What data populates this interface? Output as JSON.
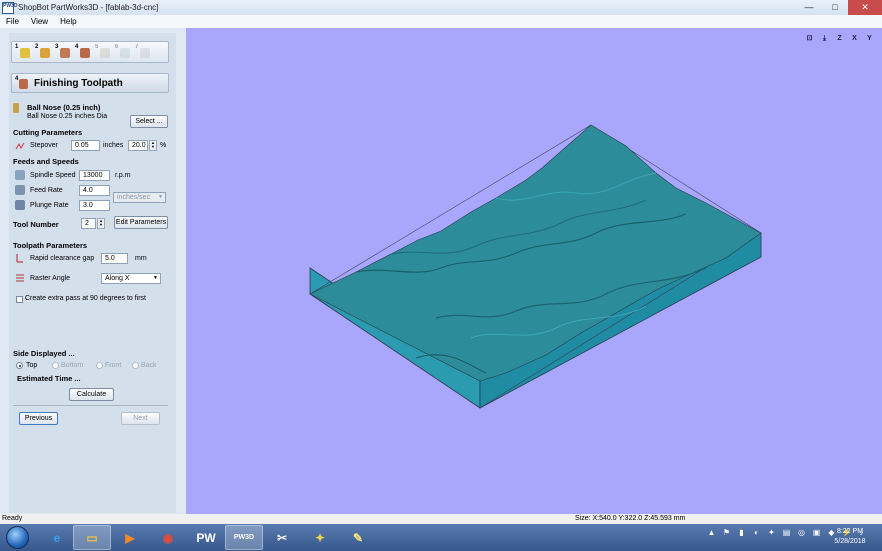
{
  "window": {
    "logo": "PW3D",
    "title": "ShopBot PartWorks3D - [fablab-3d-cnc]",
    "minimize": "—",
    "maximize": "□",
    "close": "✕"
  },
  "menu": [
    "File",
    "View",
    "Help"
  ],
  "toolbar_steps": [
    {
      "num": "1",
      "icon": "setup-icon",
      "color": "#e2c23a",
      "dim": false
    },
    {
      "num": "2",
      "icon": "orient-icon",
      "color": "#d9a23c",
      "dim": false
    },
    {
      "num": "3",
      "icon": "rough-icon",
      "color": "#c27a54",
      "dim": false
    },
    {
      "num": "4",
      "icon": "finish-icon",
      "color": "#b86a4a",
      "dim": false
    },
    {
      "num": "5",
      "icon": "cutout-icon",
      "color": "#c5b8a8",
      "dim": true
    },
    {
      "num": "6",
      "icon": "preview-icon",
      "color": "#b3c3cf",
      "dim": true
    },
    {
      "num": "7",
      "icon": "save-icon",
      "color": "#b8c2cc",
      "dim": true
    }
  ],
  "panel": {
    "step_number": "4",
    "title": "Finishing Toolpath",
    "tool_name": "Ball Nose (0.25 inch)",
    "tool_desc": "Ball Nose 0.25 inches Dia",
    "select_button": "Select ...",
    "cutting_params_heading": "Cutting Parameters",
    "stepover_label": "Stepover",
    "stepover_value": "0.05",
    "stepover_unit": "inches",
    "stepover_percent": "20.0",
    "percent_sign": "%",
    "feeds_heading": "Feeds and Speeds",
    "spindle_label": "Spindle Speed",
    "spindle_value": "13000",
    "spindle_unit": "r.p.m",
    "feed_label": "Feed Rate",
    "feed_value": "4.0",
    "rate_unit": "inches/sec",
    "plunge_label": "Plunge Rate",
    "plunge_value": "3.0",
    "tool_number_label": "Tool Number",
    "tool_number_value": "2",
    "edit_params_button": "Edit Parameters",
    "toolpath_params_heading": "Toolpath Parameters",
    "rapid_label": "Rapid clearance gap",
    "rapid_value": "5.0",
    "rapid_unit": "mm",
    "raster_label": "Raster Angle",
    "raster_value": "Along X",
    "extra_pass_label": "Create extra pass at 90 degrees to first",
    "side_heading": "Side Displayed ...",
    "side_options": [
      "Top",
      "Bottom",
      "Front",
      "Back"
    ],
    "side_selected": "Top",
    "estimated_heading": "Estimated Time ...",
    "calculate_button": "Calculate",
    "previous_button": "Previous",
    "next_button": "Next"
  },
  "view_icons": [
    "⊡",
    "⤓",
    "Z",
    "X",
    "Y"
  ],
  "status": {
    "left": "Ready",
    "right": "Size: X:540.0 Y:322.0 Z:45.593 mm"
  },
  "taskbar": {
    "apps": [
      {
        "name": "ie-icon",
        "glyph": "e",
        "color": "#3aa2e8",
        "active": false
      },
      {
        "name": "explorer-icon",
        "glyph": "▭",
        "color": "#e8c34a",
        "active": true
      },
      {
        "name": "media-player-icon",
        "glyph": "▶",
        "color": "#f08a24",
        "active": false
      },
      {
        "name": "chrome-icon",
        "glyph": "◉",
        "color": "#e44b3a",
        "active": false
      },
      {
        "name": "pw-icon",
        "glyph": "PW",
        "color": "#ffffff",
        "active": false
      },
      {
        "name": "pw3d-icon",
        "glyph": "PW3D",
        "color": "#ffffff",
        "active": true
      },
      {
        "name": "snipping-icon",
        "glyph": "✂",
        "color": "#f3f3f3",
        "active": false
      },
      {
        "name": "shopbot-icon",
        "glyph": "✦",
        "color": "#f0d04a",
        "active": false
      },
      {
        "name": "paint-icon",
        "glyph": "✎",
        "color": "#f6e27c",
        "active": false
      }
    ],
    "tray_icons": [
      "▲",
      "⚑",
      "▮",
      "◐",
      "✦",
      "▤",
      "◎",
      "▣",
      "◆",
      "⚡",
      "♪"
    ],
    "time": "8:22 PM",
    "date": "5/28/2018"
  }
}
